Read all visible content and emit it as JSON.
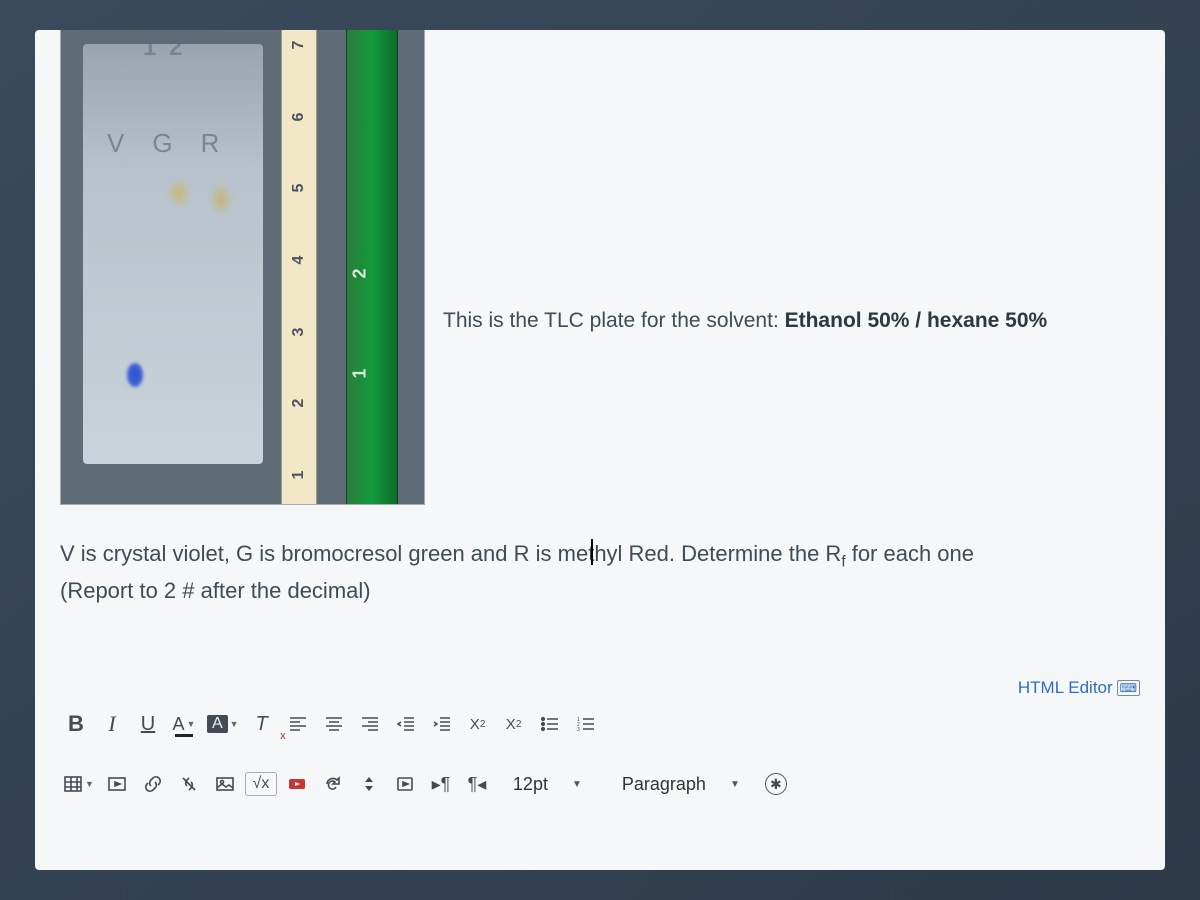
{
  "image": {
    "glass_numbers": "1 2",
    "plate_labels": "VGR",
    "ruler_marks": [
      "1",
      "2",
      "3",
      "4",
      "5",
      "6",
      "7"
    ],
    "green_marks": [
      "1",
      "2"
    ]
  },
  "caption": {
    "prefix": "This is the TLC plate for the solvent: ",
    "bold": "Ethanol 50% / hexane 50%"
  },
  "question": {
    "line1_a": "V is crystal violet, G is bromocresol green and R is me",
    "line1_b": "hyl Red. Determine the R",
    "line1_sub": "f",
    "line1_c": " for each one",
    "line2": "(Report to 2 # after the decimal)"
  },
  "editor": {
    "label": "HTML Editor",
    "font_size": "12pt",
    "paragraph": "Paragraph"
  },
  "tb": {
    "bold": "B",
    "italic": "I",
    "underline": "U",
    "fontA": "A",
    "bgA": "A",
    "clearT": "T",
    "sqrt": "√x",
    "sup": "X",
    "sub": "X",
    "ltr": "¶",
    "rtl": "¶"
  }
}
